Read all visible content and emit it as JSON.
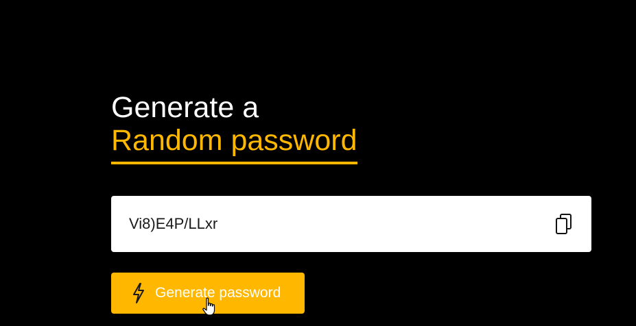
{
  "heading": {
    "line1": "Generate a",
    "line2": "Random password"
  },
  "output": {
    "password": "Vi8)E4P/LLxr",
    "copy_icon": "copy-icon"
  },
  "generate": {
    "label": "Generate password",
    "icon": "lightning-bolt-icon"
  },
  "colors": {
    "background": "#000000",
    "accent": "#ffb700",
    "field_background": "#ffffff"
  }
}
